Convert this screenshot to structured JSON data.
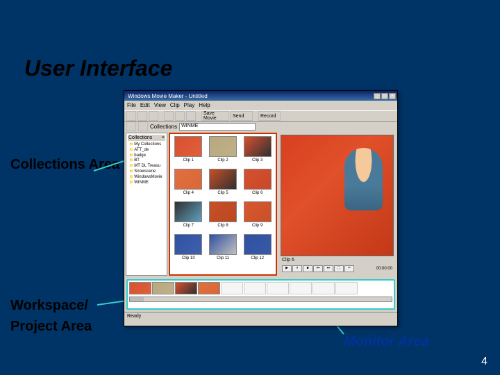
{
  "slide": {
    "title": "User Interface",
    "page": "4"
  },
  "labels": {
    "collections": "Collections Area",
    "workspace": "Workspace/",
    "project": "Project Area",
    "monitor": "Monitor Area"
  },
  "app": {
    "title": "Windows Movie Maker - Untitled",
    "menu": [
      "File",
      "Edit",
      "View",
      "Clip",
      "Play",
      "Help"
    ],
    "toolbar": {
      "saveMovie": "Save Movie",
      "send": "Send",
      "record": "Record"
    },
    "location": {
      "label": "Collections",
      "value": "WINME"
    },
    "collections": {
      "header": "Collections",
      "items": [
        "My Collections",
        "ATT_de",
        "badge",
        "BT",
        "MT DL Treasu",
        "Snowscene",
        "WindowsMovie",
        "WINME"
      ]
    },
    "clips": [
      {
        "name": "Clip 1",
        "colors": [
          "#d85030",
          "#e0603a"
        ]
      },
      {
        "name": "Clip 2",
        "colors": [
          "#b8a880",
          "#c0b088"
        ]
      },
      {
        "name": "Clip 3",
        "colors": [
          "#d85030",
          "#303030"
        ]
      },
      {
        "name": "Clip 4",
        "colors": [
          "#e07040",
          "#d86838"
        ]
      },
      {
        "name": "Clip 5",
        "colors": [
          "#c65028",
          "#303030"
        ]
      },
      {
        "name": "Clip 6",
        "colors": [
          "#d65030",
          "#c84828"
        ]
      },
      {
        "name": "Clip 7",
        "colors": [
          "#303030",
          "#60a0c0"
        ]
      },
      {
        "name": "Clip 8",
        "colors": [
          "#c85028",
          "#b84820"
        ]
      },
      {
        "name": "Clip 9",
        "colors": [
          "#d85830",
          "#c85028"
        ]
      },
      {
        "name": "Clip 10",
        "colors": [
          "#3050a0",
          "#4060b0"
        ]
      },
      {
        "name": "Clip 11",
        "colors": [
          "#3050a0",
          "#c0c0c0"
        ]
      },
      {
        "name": "Clip 12",
        "colors": [
          "#3050a0",
          "#3858a8"
        ]
      }
    ],
    "monitor": {
      "clipLabel": "Clip 6",
      "time": "00:00:00"
    },
    "timeline": {
      "filled": 4,
      "total": 10
    },
    "status": "Ready"
  }
}
